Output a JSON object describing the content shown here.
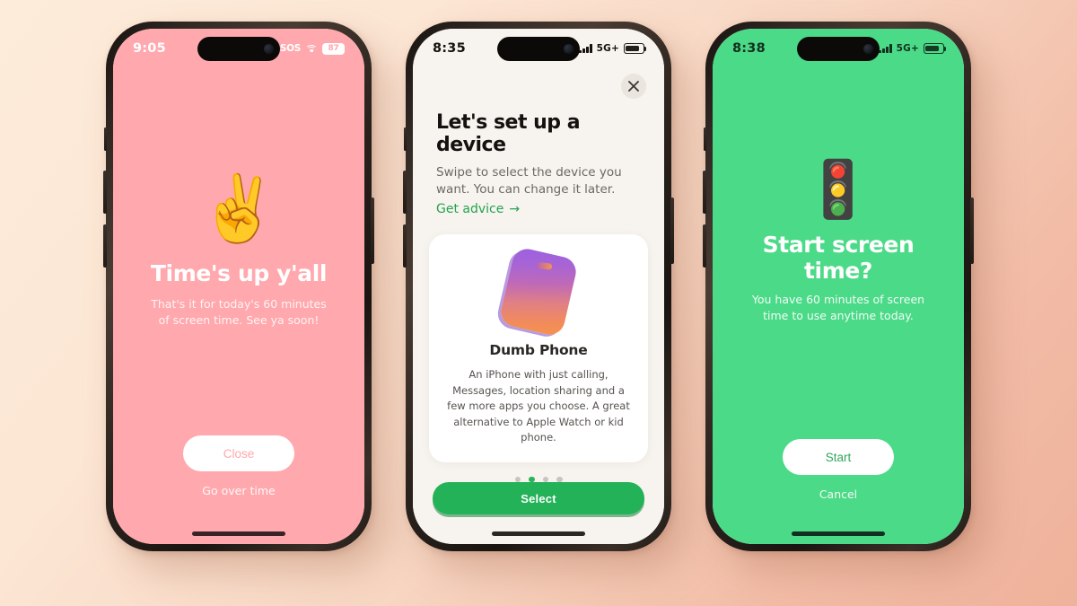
{
  "background": {
    "from": "#FDECDA",
    "to": "#EFB29B"
  },
  "phones": [
    {
      "id": "time-up",
      "screen_color": "#FFA8AD",
      "status": {
        "clock": "9:05",
        "sos": "SOS",
        "wifi_icon": "wifi-icon",
        "battery": "87"
      },
      "emoji": "✌️",
      "emoji_name": "peace-hand-emoji",
      "title": "Time's up y'all",
      "subtitle": "That's it for today's 60 minutes of screen time. See ya soon!",
      "primary_button": "Close",
      "secondary_link": "Go over time"
    },
    {
      "id": "set-up-device",
      "screen_color": "#F7F3EE",
      "status": {
        "clock": "8:35",
        "signal_icon": "cellular-bars-icon",
        "network": "5G+",
        "battery_icon": "battery-icon"
      },
      "close_icon": "close-icon",
      "title": "Let's set up a device",
      "description": "Swipe to select the device you want. You can change it later.",
      "link": "Get advice",
      "link_arrow": "→",
      "card": {
        "illustration": "dumb-phone-illustration",
        "name": "Dumb Phone",
        "description": "An iPhone with just calling, Messages, location sharing and a few more apps you choose. A great alternative to Apple Watch or kid phone."
      },
      "pagination": {
        "count": 4,
        "active_index": 1,
        "active_color": "#2BB35A",
        "inactive_color": "#C9C5BE"
      },
      "primary_button": "Select",
      "primary_button_color": "#23B257"
    },
    {
      "id": "start-screen-time",
      "screen_color": "#4BDA87",
      "status": {
        "clock": "8:38",
        "signal_icon": "cellular-bars-icon",
        "network": "5G+",
        "battery_icon": "battery-icon"
      },
      "emoji": "🚦",
      "emoji_name": "traffic-light-emoji",
      "title": "Start screen time?",
      "subtitle": "You have 60 minutes of screen time to use anytime today.",
      "primary_button": "Start",
      "secondary_link": "Cancel"
    }
  ]
}
